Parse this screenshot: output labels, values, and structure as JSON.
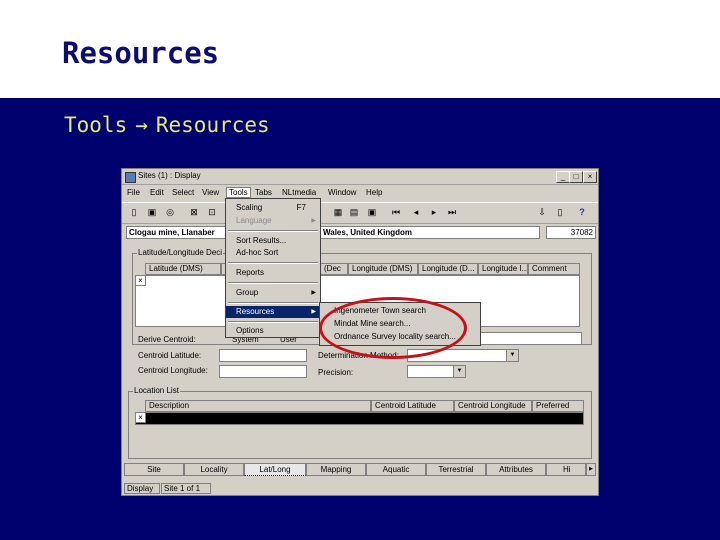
{
  "slide": {
    "title": "Resources",
    "breadcrumb": {
      "parent": "Tools",
      "arrow": "→",
      "child": "Resources"
    }
  },
  "window": {
    "title": "Sites (1) : Display",
    "controls": [
      "_",
      "□",
      "×"
    ],
    "menubar": [
      "File",
      "Edit",
      "Select",
      "View",
      "Tools",
      "Tabs",
      "NLtmedia",
      "Window",
      "Help"
    ],
    "record": {
      "name": "Clogau mine, Llanaber",
      "location_suffix": "Wales, United Kingdom",
      "id": "37082"
    },
    "latlong_group": {
      "label": "Latitude/Longitude Deci",
      "columns": [
        "Latitude (DMS)",
        "(Dec",
        "Longitude (DMS)",
        "Longitude (D...",
        "Longitude I...",
        "Comment"
      ],
      "row_marker": "×"
    },
    "form": {
      "derive_centroid": "Derive Centroid:",
      "derive_options": [
        "System",
        "User"
      ],
      "centroid_latitude": "Centroid Latitude:",
      "centroid_longitude": "Centroid Longitude:",
      "determination_method": "Determination Method:",
      "precision": "Precision:"
    },
    "location_group": {
      "label": "Location List",
      "columns": [
        "Description",
        "Centroid Latitude",
        "Centroid Longitude",
        "Preferred"
      ],
      "row_marker": "×"
    },
    "tabs": [
      "Site",
      "Locality",
      "Lat/Long",
      "Mapping",
      "Aquatic",
      "Terrestrial",
      "Attributes",
      "Hi"
    ],
    "active_tab": "Lat/Long",
    "status": {
      "mode": "Display",
      "position": "Site 1 of 1"
    }
  },
  "tools_menu": {
    "items": [
      {
        "label": "Scaling",
        "shortcut": "F7",
        "disabled": false,
        "submenu": false
      },
      {
        "label": "Language",
        "shortcut": "",
        "disabled": true,
        "submenu": true
      },
      {
        "label": "Sort Results...",
        "shortcut": "",
        "disabled": false,
        "submenu": false
      },
      {
        "label": "Ad-hoc Sort",
        "shortcut": "",
        "disabled": false,
        "submenu": false
      },
      {
        "label": "Reports",
        "shortcut": "",
        "disabled": false,
        "submenu": false
      },
      {
        "label": "Group",
        "shortcut": "",
        "disabled": false,
        "submenu": true
      },
      {
        "label": "Resources",
        "shortcut": "",
        "disabled": false,
        "submenu": true
      },
      {
        "label": "Options",
        "shortcut": "",
        "disabled": false,
        "submenu": false
      }
    ],
    "highlighted": "Resources"
  },
  "resources_submenu": {
    "items": [
      "Ingenometer Town search",
      "Mindat Mine search...",
      "Ordnance Survey locality search..."
    ]
  },
  "colors": {
    "slide_title": "#0d0d6e",
    "band": "#00006e",
    "breadcrumb": "#e8e870",
    "highlight": "#0a246a",
    "annotation": "#c4121a"
  }
}
